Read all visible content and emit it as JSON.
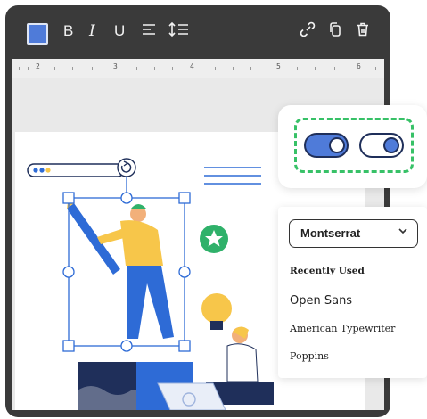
{
  "toolbar": {
    "color": "#4f7bd9",
    "bold": "B",
    "italic": "I",
    "underline": "U",
    "align_icon": "align-left-icon",
    "line_height_icon": "line-height-icon",
    "link_icon": "link-icon",
    "copy_icon": "copy-icon",
    "delete_icon": "trash-icon"
  },
  "ruler": {
    "marks": [
      "2",
      "3",
      "4",
      "5",
      "6"
    ]
  },
  "toggles": [
    {
      "state": "on",
      "color": "#4f7bd9"
    },
    {
      "state": "off",
      "color": "#ffffff"
    }
  ],
  "font_panel": {
    "selected": "Montserrat",
    "recent_heading": "Recently Used",
    "items": [
      "Open Sans",
      "American Typewriter",
      "Poppins"
    ]
  },
  "canvas": {
    "illustration": "people-working-illustration",
    "accent": "#2e6bd6",
    "badge_color": "#2fb16a",
    "bulb_color": "#f7c64a"
  }
}
